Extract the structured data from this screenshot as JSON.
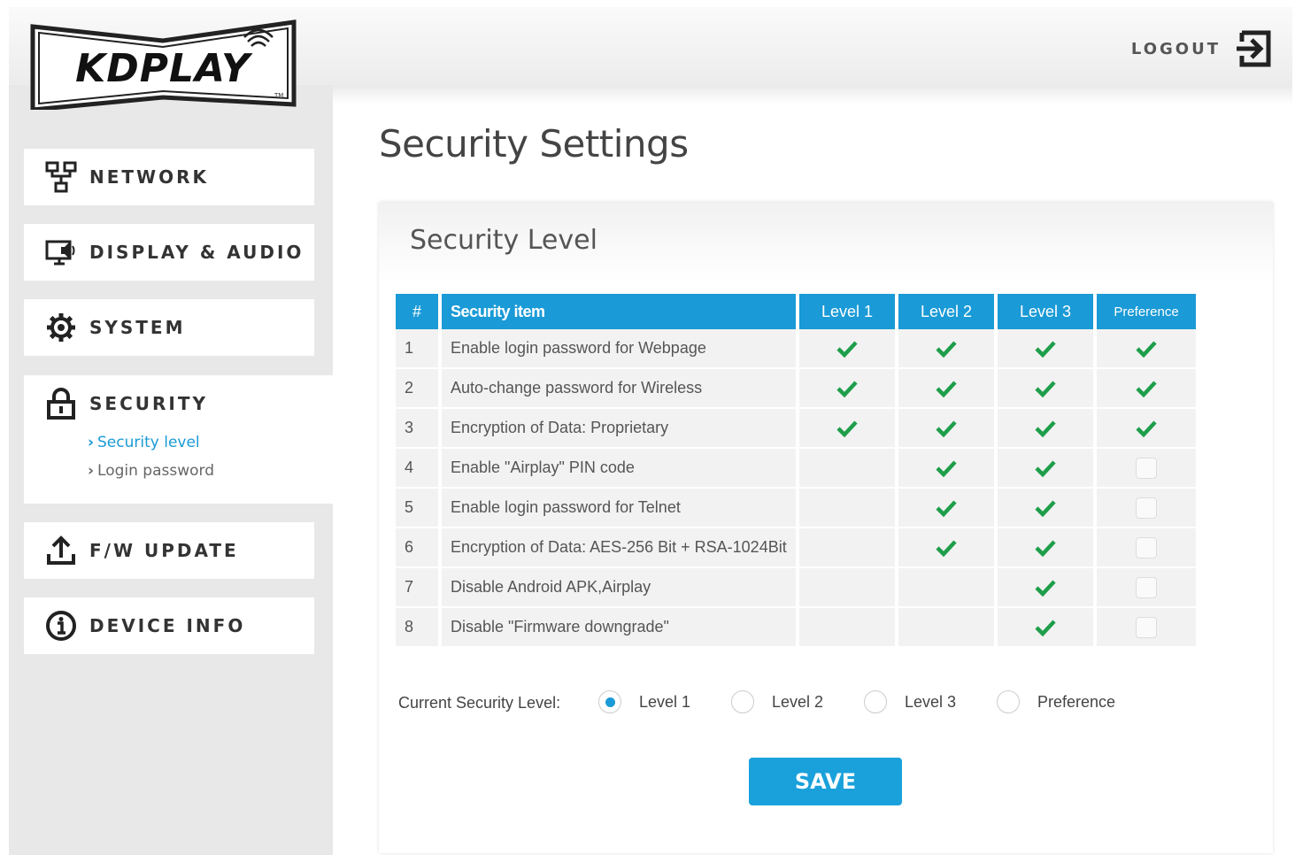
{
  "header": {
    "logo_text": "KDPLAY",
    "logo_tm": "TM",
    "logout_label": "LOGOUT"
  },
  "sidebar": {
    "items": [
      {
        "label": "NETWORK",
        "icon": "network-icon"
      },
      {
        "label": "DISPLAY & AUDIO",
        "icon": "display-audio-icon"
      },
      {
        "label": "SYSTEM",
        "icon": "gear-icon"
      },
      {
        "label": "SECURITY",
        "icon": "lock-icon"
      },
      {
        "label": "F/W UPDATE",
        "icon": "upload-icon"
      },
      {
        "label": "DEVICE INFO",
        "icon": "info-icon"
      }
    ],
    "security_sub": [
      {
        "label": "Security level",
        "active": true
      },
      {
        "label": "Login password",
        "active": false
      }
    ]
  },
  "main": {
    "page_title": "Security Settings",
    "panel_title": "Security Level",
    "table": {
      "headers": [
        "#",
        "Security item",
        "Level 1",
        "Level 2",
        "Level 3",
        "Preference"
      ],
      "rows": [
        {
          "num": "1",
          "item": "Enable login password for Webpage",
          "l1": true,
          "l2": true,
          "l3": true,
          "pref": true
        },
        {
          "num": "2",
          "item": "Auto-change password for Wireless",
          "l1": true,
          "l2": true,
          "l3": true,
          "pref": true
        },
        {
          "num": "3",
          "item": "Encryption of Data: Proprietary",
          "l1": true,
          "l2": true,
          "l3": true,
          "pref": true
        },
        {
          "num": "4",
          "item": "Enable \"Airplay\" PIN code",
          "l1": false,
          "l2": true,
          "l3": true,
          "pref": false
        },
        {
          "num": "5",
          "item": "Enable login password for Telnet",
          "l1": false,
          "l2": true,
          "l3": true,
          "pref": false
        },
        {
          "num": "6",
          "item": "Encryption of Data: AES-256 Bit + RSA-1024Bit",
          "l1": false,
          "l2": true,
          "l3": true,
          "pref": false
        },
        {
          "num": "7",
          "item": "Disable Android APK,Airplay",
          "l1": false,
          "l2": false,
          "l3": true,
          "pref": false
        },
        {
          "num": "8",
          "item": "Disable \"Firmware downgrade\"",
          "l1": false,
          "l2": false,
          "l3": true,
          "pref": false
        }
      ]
    },
    "current_level_label": "Current Security Level:",
    "level_options": [
      {
        "label": "Level 1",
        "checked": true
      },
      {
        "label": "Level 2",
        "checked": false
      },
      {
        "label": "Level 3",
        "checked": false
      },
      {
        "label": "Preference",
        "checked": false
      }
    ],
    "save_label": "SAVE"
  },
  "colors": {
    "accent": "#1a9ad6",
    "check": "#1e9e4a",
    "sidebar_bg": "#e8e8e8"
  }
}
